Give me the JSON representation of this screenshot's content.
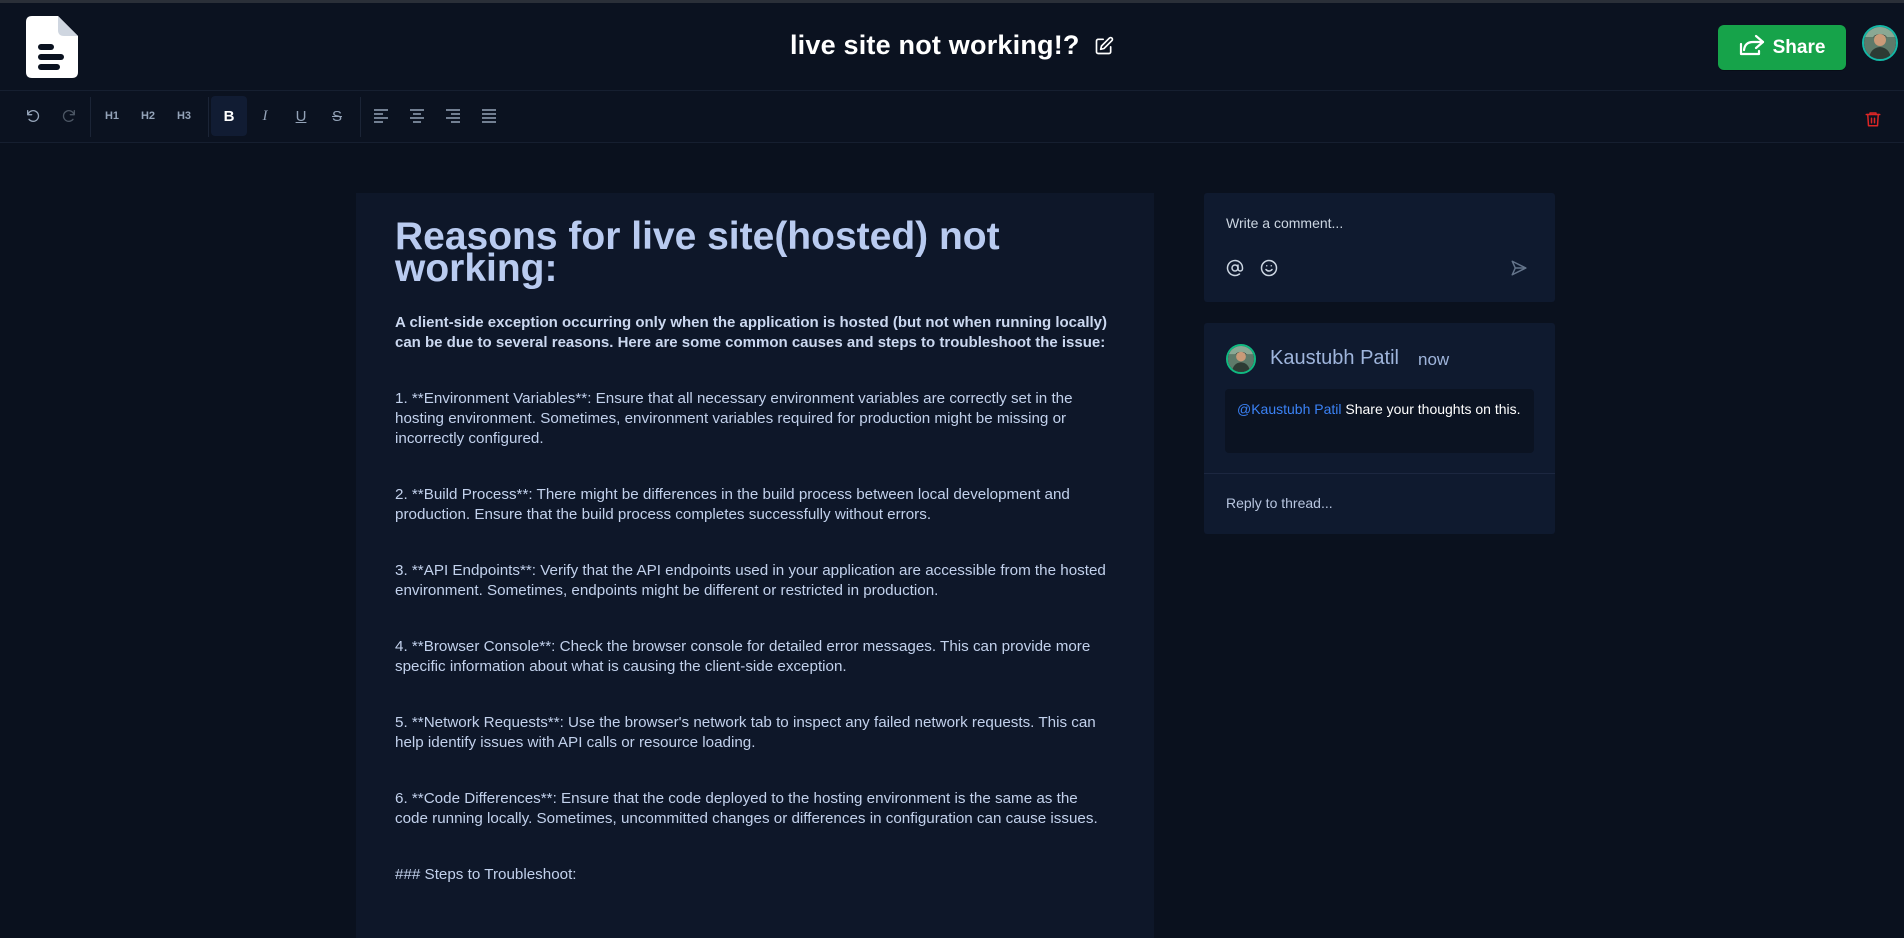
{
  "header": {
    "title": "live site not working!?",
    "share_label": "Share"
  },
  "toolbar": {
    "h1": "H1",
    "h2": "H2",
    "h3": "H3",
    "bold": "B",
    "italic": "I",
    "underline": "U",
    "strike": "S"
  },
  "document": {
    "heading": "Reasons for live site(hosted) not working:",
    "lead": "A client-side exception occurring only when the application is hosted (but not when running locally) can be due to several reasons. Here are some common causes and steps to troubleshoot the issue:",
    "paragraphs": [
      "1. **Environment Variables**: Ensure that all necessary environment variables are correctly set in the hosting environment. Sometimes, environment variables required for production might be missing or incorrectly configured.",
      "2. **Build Process**: There might be differences in the build process between local development and production. Ensure that the build process completes successfully without errors.",
      "3. **API Endpoints**: Verify that the API endpoints used in your application are accessible from the hosted environment. Sometimes, endpoints might be different or restricted in production.",
      "4. **Browser Console**: Check the browser console for detailed error messages. This can provide more specific information about what is causing the client-side exception.",
      "5. **Network Requests**: Use the browser's network tab to inspect any failed network requests. This can help identify issues with API calls or resource loading.",
      "6. **Code Differences**: Ensure that the code deployed to the hosting environment is the same as the code running locally. Sometimes, uncommitted changes or differences in configuration can cause issues."
    ],
    "steps_heading": "### Steps to Troubleshoot:"
  },
  "comment": {
    "placeholder": "Write a comment..."
  },
  "thread": {
    "author": "Kaustubh Patil",
    "time": "now",
    "mention": "@Kaustubh Patil",
    "message": " Share your thoughts on this.",
    "reply_placeholder": "Reply to thread..."
  },
  "colors": {
    "share_green": "#16a34a",
    "mention_blue": "#3b82f6",
    "trash_red": "#dc2626"
  }
}
